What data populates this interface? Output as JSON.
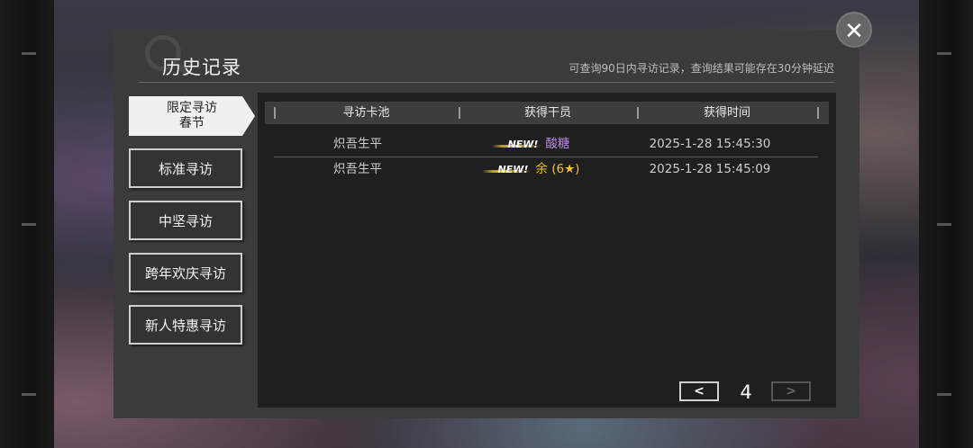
{
  "dialog": {
    "title": "历史记录",
    "subtitle": "可查询90日内寻访记录，查询结果可能存在30分钟延迟"
  },
  "close_icon": "close-icon",
  "tabs": [
    {
      "label": "限定寻访\n春节",
      "active": true
    },
    {
      "label": "标准寻访",
      "active": false
    },
    {
      "label": "中坚寻访",
      "active": false
    },
    {
      "label": "跨年欢庆寻访",
      "active": false
    },
    {
      "label": "新人特惠寻访",
      "active": false
    }
  ],
  "table": {
    "headers": [
      "寻访卡池",
      "获得干员",
      "获得时间"
    ],
    "rows": [
      {
        "pool": "炽吾生平",
        "badge": "NEW!",
        "operator": "酸糖",
        "operator_color": "#b98ce0",
        "time": "2025-1-28 15:45:30"
      },
      {
        "pool": "炽吾生平",
        "badge": "NEW!",
        "operator": "余 (6★)",
        "operator_color": "#f2c230",
        "time": "2025-1-28 15:45:09"
      }
    ]
  },
  "pager": {
    "page": "4",
    "prev_icon": "chevron-left-icon",
    "next_icon": "chevron-right-icon"
  }
}
